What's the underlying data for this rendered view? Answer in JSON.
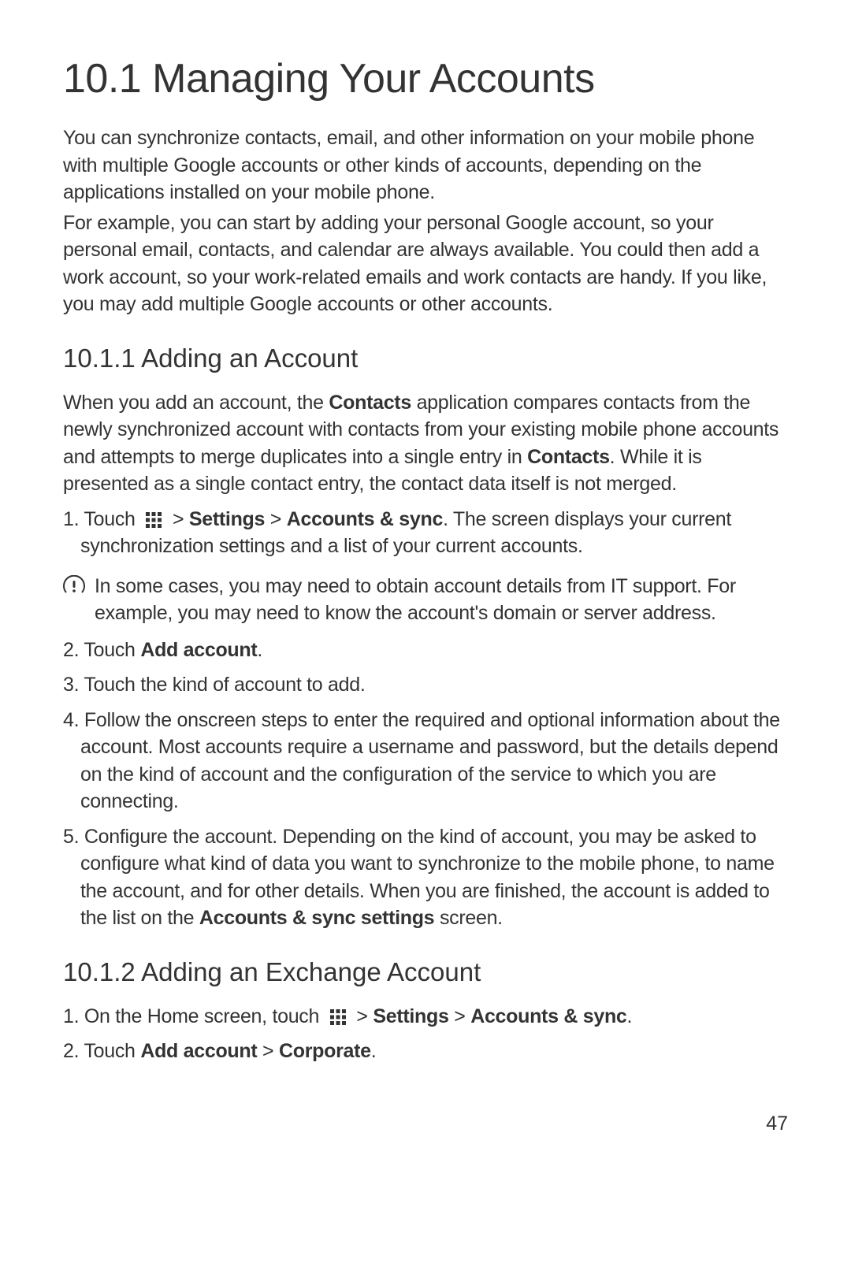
{
  "title": "10.1  Managing Your Accounts",
  "intro_p1": "You can synchronize contacts, email, and other information on your mobile phone with multiple Google accounts or other kinds of accounts, depending on the applications installed on your mobile phone.",
  "intro_p2": "For example, you can start by adding your personal Google account, so your personal email, contacts, and calendar are always available. You could then add a work account, so your work-related emails and work contacts are handy. If you like, you may add multiple Google accounts or other accounts.",
  "section1": {
    "heading": "10.1.1  Adding an Account",
    "para_before": "When you add an account, the ",
    "bold_contacts": "Contacts",
    "para_mid": " application compares contacts from the newly synchronized account with contacts from your existing mobile phone accounts and attempts to merge duplicates into a single entry in ",
    "para_after": ". While it is presented as a single contact entry, the contact data itself is not merged.",
    "step1_prefix": "1. Touch ",
    "step1_gt1": " > ",
    "step1_settings": "Settings",
    "step1_gt2": " > ",
    "step1_accounts": "Accounts & sync",
    "step1_suffix": ". The screen displays your current synchronization settings and a list of your current accounts.",
    "note": "In some cases, you may need to obtain account details from IT support. For example, you may need to know the account's domain or server address.",
    "step2_prefix": "2. Touch ",
    "step2_bold": "Add account",
    "step2_suffix": ".",
    "step3": "3. Touch the kind of account to add.",
    "step4": "4. Follow the onscreen steps to enter the required and optional information about the account. Most accounts require a username and password, but the details depend on the kind of account and the configuration of the service to which you are connecting.",
    "step5_prefix": "5. Configure the account. Depending on the kind of account, you may be asked to configure what kind of data you want to synchronize to the mobile phone, to name the account, and for other details. When you are finished, the account is added to the list on the ",
    "step5_bold": "Accounts & sync settings",
    "step5_suffix": " screen."
  },
  "section2": {
    "heading": "10.1.2  Adding an Exchange Account",
    "step1_prefix": "1. On the Home screen, touch ",
    "step1_gt1": " > ",
    "step1_settings": "Settings",
    "step1_gt2": " > ",
    "step1_accounts": "Accounts & sync",
    "step1_suffix": ".",
    "step2_prefix": "2. Touch ",
    "step2_bold1": "Add account",
    "step2_gt": " > ",
    "step2_bold2": "Corporate",
    "step2_suffix": "."
  },
  "page_number": "47"
}
